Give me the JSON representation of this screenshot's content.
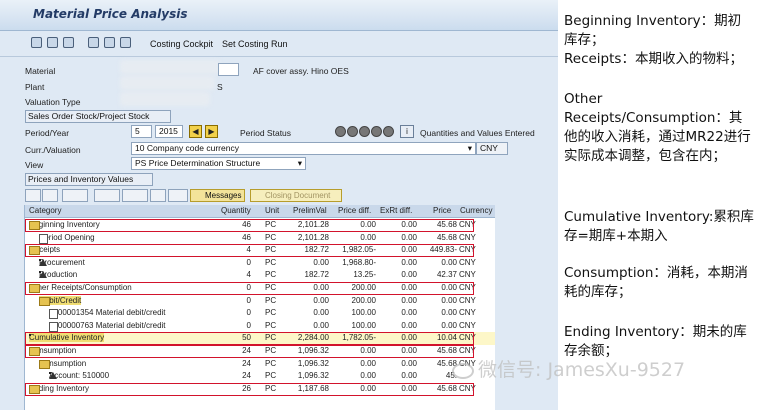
{
  "app": {
    "title": "Material Price Analysis",
    "toolbar": {
      "costing_cockpit": "Costing Cockpit",
      "set_costing_run": "Set Costing Run"
    }
  },
  "header": {
    "material_label": "Material",
    "material_desc": "AF cover assy. Hino OES",
    "plant_label": "Plant",
    "plant_suffix": "S",
    "valuation_type_label": "Valuation Type",
    "sales_order_btn": "Sales Order Stock/Project Stock",
    "period_year_label": "Period/Year",
    "period": "5",
    "year": "2015",
    "period_status_label": "Period Status",
    "quantities_label": "Quantities and Values Entered",
    "curr_valuation_label": "Curr./Valuation",
    "curr_valuation_value": "10 Company code currency",
    "currency": "CNY",
    "view_label": "View",
    "view_value": "PS Price Determination Structure",
    "prices_btn": "Prices and Inventory Values"
  },
  "grid_toolbar": {
    "messages": "Messages",
    "closing_document": "Closing Document"
  },
  "columns": {
    "category": "Category",
    "quantity": "Quantity",
    "unit": "Unit",
    "prelimval": "PrelimVal",
    "price_diff": "Price diff.",
    "exrt_diff": "ExRt diff.",
    "price": "Price",
    "currency": "Currency"
  },
  "rows": [
    {
      "category": "Beginning Inventory",
      "quantity": "46",
      "unit": "PC",
      "prelimval": "2,101.28",
      "price_diff": "0.00",
      "exrt_diff": "0.00",
      "price": "45.68",
      "currency": "CNY"
    },
    {
      "category": "Period Opening",
      "quantity": "46",
      "unit": "PC",
      "prelimval": "2,101.28",
      "price_diff": "0.00",
      "exrt_diff": "0.00",
      "price": "45.68",
      "currency": "CNY"
    },
    {
      "category": "Receipts",
      "quantity": "4",
      "unit": "PC",
      "prelimval": "182.72",
      "price_diff": "1,982.05-",
      "exrt_diff": "0.00",
      "price": "449.83-",
      "currency": "CNY"
    },
    {
      "category": "Procurement",
      "quantity": "0",
      "unit": "PC",
      "prelimval": "0.00",
      "price_diff": "1,968.80-",
      "exrt_diff": "0.00",
      "price": "0.00",
      "currency": "CNY"
    },
    {
      "category": "Production",
      "quantity": "4",
      "unit": "PC",
      "prelimval": "182.72",
      "price_diff": "13.25-",
      "exrt_diff": "0.00",
      "price": "42.37",
      "currency": "CNY"
    },
    {
      "category": "Other Receipts/Consumption",
      "quantity": "0",
      "unit": "PC",
      "prelimval": "0.00",
      "price_diff": "200.00",
      "exrt_diff": "0.00",
      "price": "0.00",
      "currency": "CNY"
    },
    {
      "category": "Debit/Credit",
      "quantity": "0",
      "unit": "PC",
      "prelimval": "0.00",
      "price_diff": "200.00",
      "exrt_diff": "0.00",
      "price": "0.00",
      "currency": "CNY"
    },
    {
      "category": "1000001354 Material debit/credit",
      "quantity": "0",
      "unit": "PC",
      "prelimval": "0.00",
      "price_diff": "100.00",
      "exrt_diff": "0.00",
      "price": "0.00",
      "currency": "CNY"
    },
    {
      "category": "1000000763 Material debit/credit",
      "quantity": "0",
      "unit": "PC",
      "prelimval": "0.00",
      "price_diff": "100.00",
      "exrt_diff": "0.00",
      "price": "0.00",
      "currency": "CNY"
    },
    {
      "category": "Cumulative Inventory",
      "quantity": "50",
      "unit": "PC",
      "prelimval": "2,284.00",
      "price_diff": "1,782.05-",
      "exrt_diff": "0.00",
      "price": "10.04",
      "currency": "CNY"
    },
    {
      "category": "Consumption",
      "quantity": "24",
      "unit": "PC",
      "prelimval": "1,096.32",
      "price_diff": "0.00",
      "exrt_diff": "0.00",
      "price": "45.68",
      "currency": "CNY"
    },
    {
      "category": "Consumption",
      "quantity": "24",
      "unit": "PC",
      "prelimval": "1,096.32",
      "price_diff": "0.00",
      "exrt_diff": "0.00",
      "price": "45.68",
      "currency": "CNY"
    },
    {
      "category": "Account: 510000",
      "quantity": "24",
      "unit": "PC",
      "prelimval": "1,096.32",
      "price_diff": "0.00",
      "exrt_diff": "0.00",
      "price": "45.",
      "currency": ""
    },
    {
      "category": "Ending Inventory",
      "quantity": "26",
      "unit": "PC",
      "prelimval": "1,187.68",
      "price_diff": "0.00",
      "exrt_diff": "0.00",
      "price": "45.68",
      "currency": "CNY"
    }
  ],
  "notes": {
    "n1": "Beginning Inventory：期初库存；",
    "n2": "Receipts：本期收入的物料；",
    "n3": "Other Receipts/Consumption：其他的收入消耗，通过MR22进行实际成本调整，包含在内；",
    "n4": "Cumulative Inventory:累积库存=期库+本期入",
    "n5": "Consumption：消耗，本期消耗的库存；",
    "n6": "Ending Inventory：期未的库存余额；"
  },
  "watermark": "微信号: JamesXu-9527"
}
